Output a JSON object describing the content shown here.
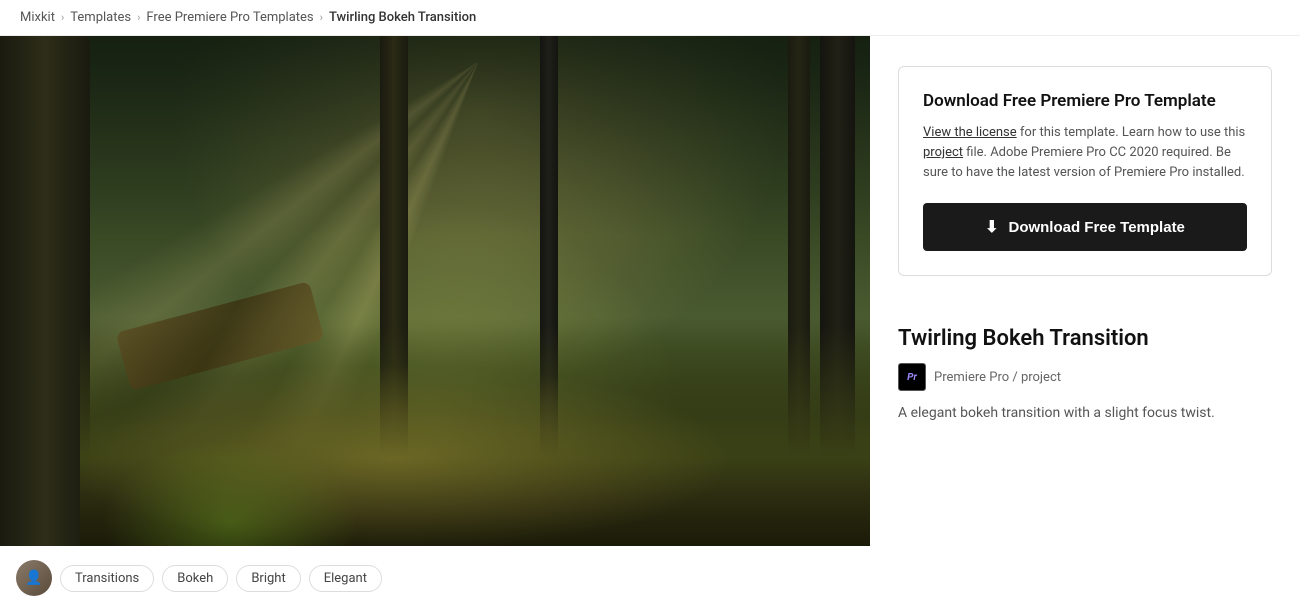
{
  "breadcrumb": {
    "items": [
      {
        "label": "Mixkit",
        "href": "#"
      },
      {
        "label": "Templates",
        "href": "#"
      },
      {
        "label": "Free Premiere Pro Templates",
        "href": "#"
      },
      {
        "label": "Twirling Bokeh Transition",
        "href": null
      }
    ],
    "separators": [
      "›",
      "›",
      "›"
    ]
  },
  "download_card": {
    "title": "Download Free Premiere Pro Template",
    "license_prefix": "",
    "license_link_text": "View the license",
    "license_text_after": " for this template. Learn how to use this",
    "project_link_text": "project",
    "license_text_end": " file. Adobe Premiere Pro CC 2020 required. Be sure to have the latest version of Premiere Pro installed.",
    "button_label": "Download Free Template",
    "download_icon": "⬇"
  },
  "template": {
    "title": "Twirling Bokeh Transition",
    "app_badge": "Pr",
    "app_label": "Premiere Pro / project",
    "description": "A elegant bokeh transition with a slight focus twist."
  },
  "tags": [
    {
      "label": "Transitions"
    },
    {
      "label": "Bokeh"
    },
    {
      "label": "Bright"
    },
    {
      "label": "Elegant"
    }
  ],
  "avatar": {
    "icon": "👤"
  }
}
